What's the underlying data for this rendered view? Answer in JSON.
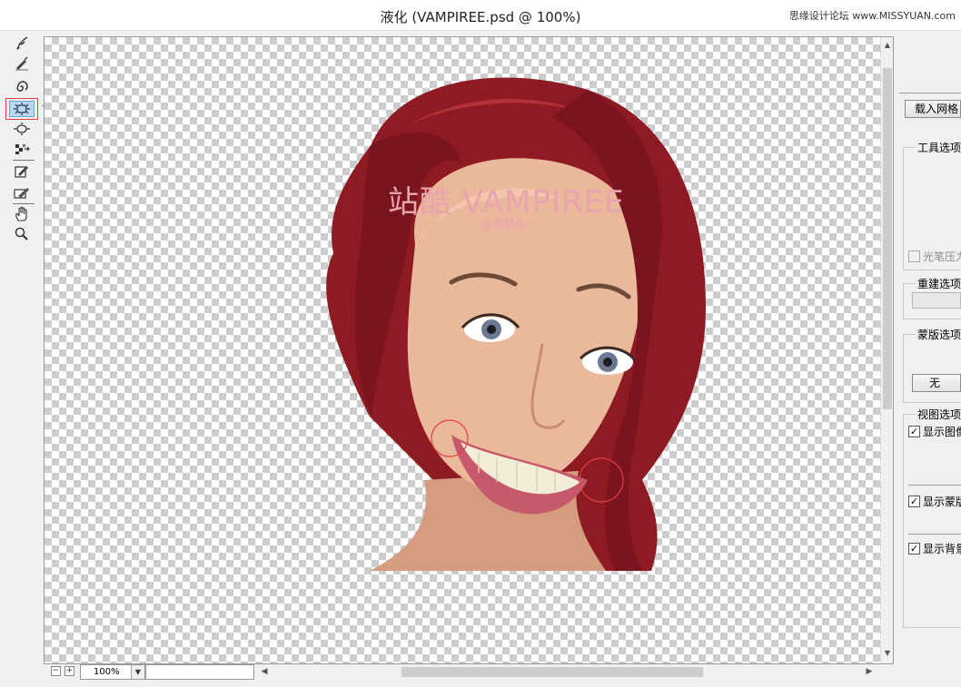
{
  "window": {
    "title": "液化 (VAMPIREE.psd @ 100%)",
    "watermark": "思缘设计论坛 www.MISSYUAN.com"
  },
  "toolbar": {
    "tools": [
      {
        "name": "forward-warp-tool",
        "icon": "warp-brush-icon"
      },
      {
        "name": "reconstruct-tool",
        "icon": "reconstruct-brush-icon"
      },
      {
        "name": "twirl-tool",
        "icon": "twirl-icon"
      },
      {
        "name": "bloat-tool",
        "icon": "bloat-icon",
        "active": true
      },
      {
        "name": "push-left-tool",
        "icon": "push-left-icon"
      },
      {
        "name": "mirror-tool",
        "icon": "mirror-icon"
      },
      {
        "name": "freeze-mask-tool",
        "icon": "freeze-mask-icon"
      },
      {
        "name": "thaw-mask-tool",
        "icon": "thaw-mask-icon"
      },
      {
        "name": "hand-tool",
        "icon": "hand-icon"
      },
      {
        "name": "zoom-tool",
        "icon": "magnifier-icon"
      }
    ]
  },
  "canvas": {
    "photo_title": "站酷 VAMPIREE",
    "photo_credit": "@周鹏Rc"
  },
  "statusbar": {
    "zoom_out_label": "−",
    "zoom_in_label": "+",
    "zoom_value": "100%"
  },
  "panel": {
    "load_mesh_label": "载入网格",
    "tool_options_label": "工具选项",
    "stylus_pressure_label": "光笔压力",
    "reconstruct_options_label": "重建选项",
    "mask_options_label": "蒙版选项",
    "mask_none_label": "无",
    "view_options_label": "视图选项",
    "show_image_label": "显示图像",
    "show_mask_label": "显示蒙版",
    "show_backdrop_label": "显示背景"
  },
  "colors": {
    "accent_active": "#b9d8ef",
    "annotation_red": "#e04040",
    "hair": "#8e1b24"
  }
}
